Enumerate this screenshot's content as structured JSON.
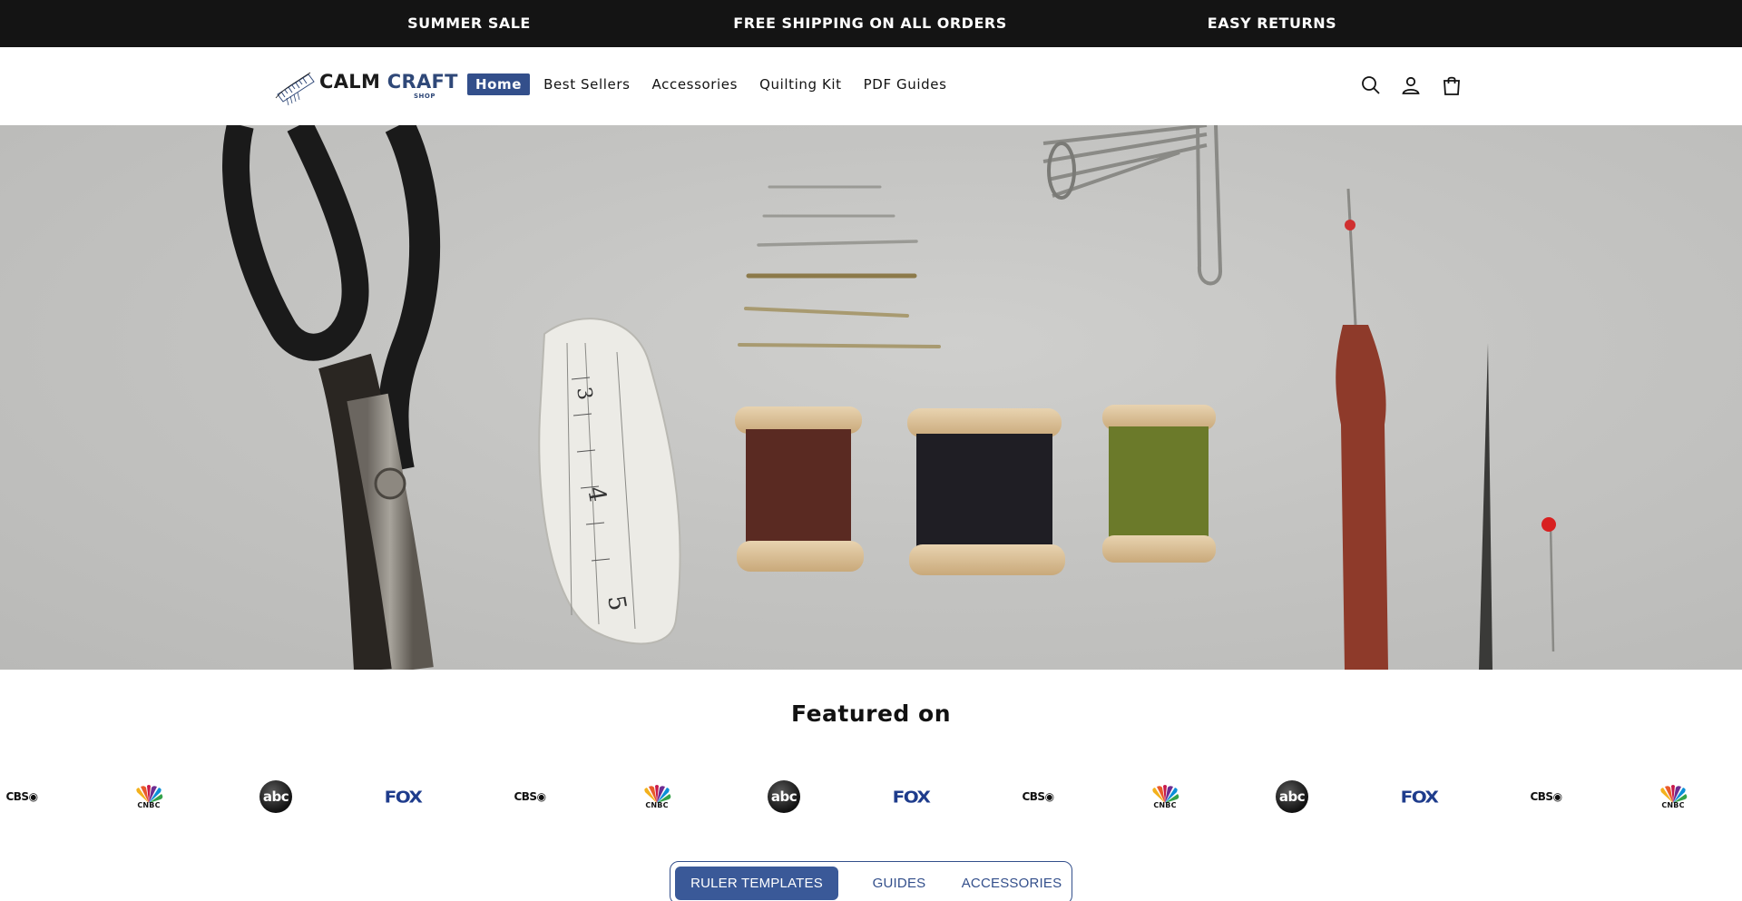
{
  "announcement": {
    "items": [
      "SUMMER SALE",
      "FREE SHIPPING ON ALL ORDERS",
      "EASY RETURNS"
    ]
  },
  "header": {
    "logo": {
      "word1": "CALM",
      "word2": "CRAFT",
      "word3": "SHOP"
    },
    "nav": [
      "Home",
      "Best Sellers",
      "Accessories",
      "Quilting Kit",
      "PDF Guides"
    ],
    "active_nav": "Home",
    "icons": [
      "search-icon",
      "account-icon",
      "cart-icon"
    ]
  },
  "hero": {
    "image": "flat-lay of sewing tools: scissors, tape measure, needles, thread spools, safety pins, seam ripper"
  },
  "featured": {
    "title": "Featured on",
    "logos": [
      "CBS",
      "CNBC",
      "abc",
      "FOX",
      "CBS",
      "CNBC",
      "abc",
      "FOX",
      "CBS",
      "CNBC",
      "abc",
      "FOX",
      "CBS",
      "CNBC"
    ]
  },
  "tabs": {
    "items": [
      "RULER TEMPLATES",
      "GUIDES",
      "ACCESSORIES"
    ],
    "active": "RULER TEMPLATES"
  },
  "colors": {
    "announcement_bg": "#141414",
    "accent": "#334f8b",
    "fox_blue": "#1e3c8c"
  }
}
